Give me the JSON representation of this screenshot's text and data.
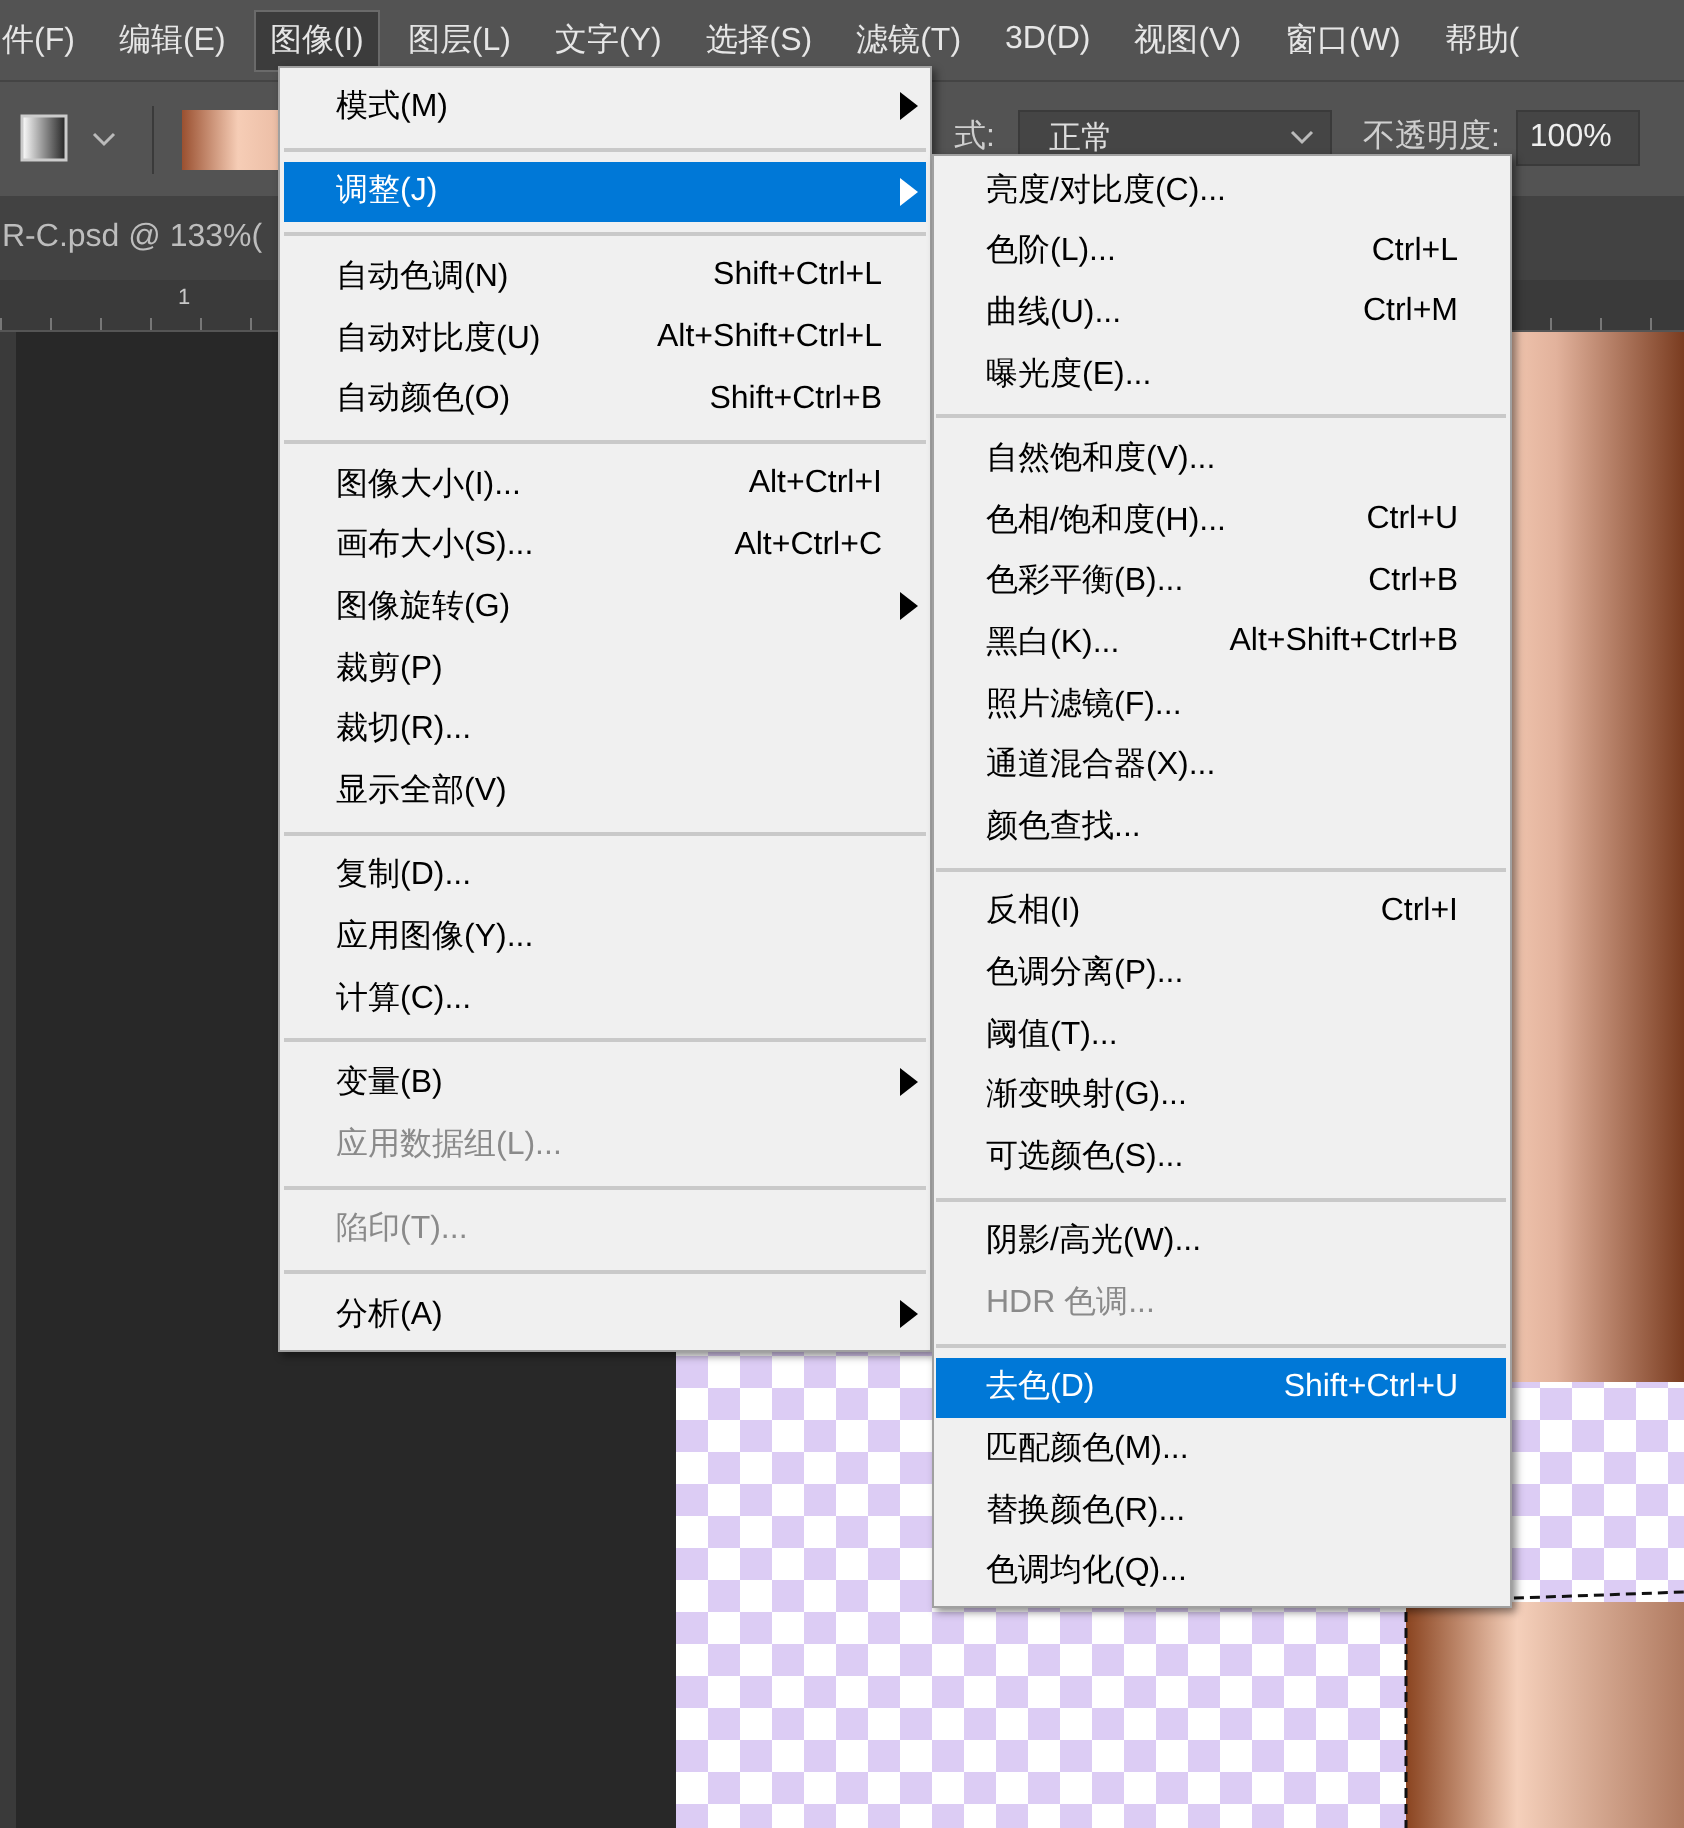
{
  "menubar": [
    {
      "label": "件(F)",
      "selected": false
    },
    {
      "label": "编辑(E)",
      "selected": false
    },
    {
      "label": "图像(I)",
      "selected": true
    },
    {
      "label": "图层(L)",
      "selected": false
    },
    {
      "label": "文字(Y)",
      "selected": false
    },
    {
      "label": "选择(S)",
      "selected": false
    },
    {
      "label": "滤镜(T)",
      "selected": false
    },
    {
      "label": "3D(D)",
      "selected": false
    },
    {
      "label": "视图(V)",
      "selected": false
    },
    {
      "label": "窗口(W)",
      "selected": false
    },
    {
      "label": "帮助(",
      "selected": false
    }
  ],
  "options_bar": {
    "mode_label": "式:",
    "mode_value": "正常",
    "opacity_label": "不透明度:",
    "opacity_value": "100%"
  },
  "document_tab": {
    "title": "R-C.psd @ 133%("
  },
  "ruler": {
    "label": "1"
  },
  "image_menu": {
    "items": [
      {
        "kind": "item",
        "label": "模式(M)",
        "submenu": true,
        "disabled": false,
        "selected": false
      },
      {
        "kind": "separator"
      },
      {
        "kind": "item",
        "label": "调整(J)",
        "submenu": true,
        "disabled": false,
        "selected": true
      },
      {
        "kind": "separator"
      },
      {
        "kind": "item",
        "label": "自动色调(N)",
        "shortcut": "Shift+Ctrl+L",
        "submenu": false,
        "disabled": false,
        "selected": false
      },
      {
        "kind": "item",
        "label": "自动对比度(U)",
        "shortcut": "Alt+Shift+Ctrl+L",
        "submenu": false,
        "disabled": false,
        "selected": false
      },
      {
        "kind": "item",
        "label": "自动颜色(O)",
        "shortcut": "Shift+Ctrl+B",
        "submenu": false,
        "disabled": false,
        "selected": false
      },
      {
        "kind": "separator"
      },
      {
        "kind": "item",
        "label": "图像大小(I)...",
        "shortcut": "Alt+Ctrl+I",
        "submenu": false,
        "disabled": false,
        "selected": false
      },
      {
        "kind": "item",
        "label": "画布大小(S)...",
        "shortcut": "Alt+Ctrl+C",
        "submenu": false,
        "disabled": false,
        "selected": false
      },
      {
        "kind": "item",
        "label": "图像旋转(G)",
        "submenu": true,
        "disabled": false,
        "selected": false
      },
      {
        "kind": "item",
        "label": "裁剪(P)",
        "submenu": false,
        "disabled": false,
        "selected": false
      },
      {
        "kind": "item",
        "label": "裁切(R)...",
        "submenu": false,
        "disabled": false,
        "selected": false
      },
      {
        "kind": "item",
        "label": "显示全部(V)",
        "submenu": false,
        "disabled": false,
        "selected": false
      },
      {
        "kind": "separator"
      },
      {
        "kind": "item",
        "label": "复制(D)...",
        "submenu": false,
        "disabled": false,
        "selected": false
      },
      {
        "kind": "item",
        "label": "应用图像(Y)...",
        "submenu": false,
        "disabled": false,
        "selected": false
      },
      {
        "kind": "item",
        "label": "计算(C)...",
        "submenu": false,
        "disabled": false,
        "selected": false
      },
      {
        "kind": "separator"
      },
      {
        "kind": "item",
        "label": "变量(B)",
        "submenu": true,
        "disabled": false,
        "selected": false
      },
      {
        "kind": "item",
        "label": "应用数据组(L)...",
        "submenu": false,
        "disabled": true,
        "selected": false
      },
      {
        "kind": "separator"
      },
      {
        "kind": "item",
        "label": "陷印(T)...",
        "submenu": false,
        "disabled": true,
        "selected": false
      },
      {
        "kind": "separator"
      },
      {
        "kind": "item",
        "label": "分析(A)",
        "submenu": true,
        "disabled": false,
        "selected": false
      }
    ]
  },
  "adjust_submenu": {
    "items": [
      {
        "kind": "item",
        "label": "亮度/对比度(C)...",
        "disabled": false,
        "selected": false
      },
      {
        "kind": "item",
        "label": "色阶(L)...",
        "shortcut": "Ctrl+L",
        "disabled": false,
        "selected": false
      },
      {
        "kind": "item",
        "label": "曲线(U)...",
        "shortcut": "Ctrl+M",
        "disabled": false,
        "selected": false
      },
      {
        "kind": "item",
        "label": "曝光度(E)...",
        "disabled": false,
        "selected": false
      },
      {
        "kind": "separator"
      },
      {
        "kind": "item",
        "label": "自然饱和度(V)...",
        "disabled": false,
        "selected": false
      },
      {
        "kind": "item",
        "label": "色相/饱和度(H)...",
        "shortcut": "Ctrl+U",
        "disabled": false,
        "selected": false
      },
      {
        "kind": "item",
        "label": "色彩平衡(B)...",
        "shortcut": "Ctrl+B",
        "disabled": false,
        "selected": false
      },
      {
        "kind": "item",
        "label": "黑白(K)...",
        "shortcut": "Alt+Shift+Ctrl+B",
        "disabled": false,
        "selected": false
      },
      {
        "kind": "item",
        "label": "照片滤镜(F)...",
        "disabled": false,
        "selected": false
      },
      {
        "kind": "item",
        "label": "通道混合器(X)...",
        "disabled": false,
        "selected": false
      },
      {
        "kind": "item",
        "label": "颜色查找...",
        "disabled": false,
        "selected": false
      },
      {
        "kind": "separator"
      },
      {
        "kind": "item",
        "label": "反相(I)",
        "shortcut": "Ctrl+I",
        "disabled": false,
        "selected": false
      },
      {
        "kind": "item",
        "label": "色调分离(P)...",
        "disabled": false,
        "selected": false
      },
      {
        "kind": "item",
        "label": "阈值(T)...",
        "disabled": false,
        "selected": false
      },
      {
        "kind": "item",
        "label": "渐变映射(G)...",
        "disabled": false,
        "selected": false
      },
      {
        "kind": "item",
        "label": "可选颜色(S)...",
        "disabled": false,
        "selected": false
      },
      {
        "kind": "separator"
      },
      {
        "kind": "item",
        "label": "阴影/高光(W)...",
        "disabled": false,
        "selected": false
      },
      {
        "kind": "item",
        "label": "HDR 色调...",
        "disabled": true,
        "selected": false
      },
      {
        "kind": "separator"
      },
      {
        "kind": "item",
        "label": "去色(D)",
        "shortcut": "Shift+Ctrl+U",
        "disabled": false,
        "selected": true
      },
      {
        "kind": "item",
        "label": "匹配颜色(M)...",
        "disabled": false,
        "selected": false
      },
      {
        "kind": "item",
        "label": "替换颜色(R)...",
        "disabled": false,
        "selected": false
      },
      {
        "kind": "item",
        "label": "色调均化(Q)...",
        "disabled": false,
        "selected": false
      }
    ]
  }
}
